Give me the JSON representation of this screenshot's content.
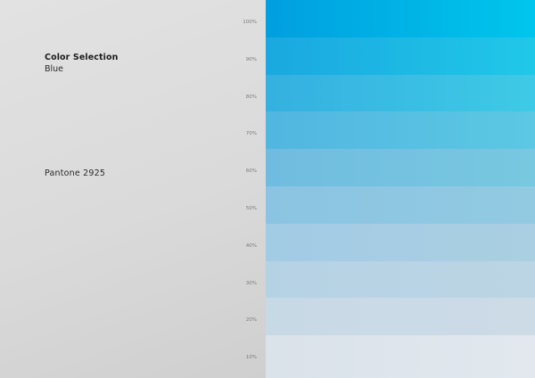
{
  "selection": {
    "heading": "Color Selection",
    "color_name": "Blue",
    "pantone": "Pantone 2925"
  },
  "tints": [
    {
      "label": "100%",
      "tint": 1.0,
      "color_start": "#009fdf",
      "color_end": "#00c6ec"
    },
    {
      "label": "90%",
      "tint": 0.9,
      "color_start": "#1aa8e0",
      "color_end": "#20c8e8"
    },
    {
      "label": "80%",
      "tint": 0.8,
      "color_start": "#35b0e0",
      "color_end": "#3ecae6"
    },
    {
      "label": "70%",
      "tint": 0.7,
      "color_start": "#52b6e0",
      "color_end": "#5cc8e4"
    },
    {
      "label": "60%",
      "tint": 0.6,
      "color_start": "#70bce0",
      "color_end": "#78c8e0"
    },
    {
      "label": "50%",
      "tint": 0.5,
      "color_start": "#8bc4e2",
      "color_end": "#92cae2"
    },
    {
      "label": "40%",
      "tint": 0.4,
      "color_start": "#a2cbe4",
      "color_end": "#aacfe2"
    },
    {
      "label": "30%",
      "tint": 0.3,
      "color_start": "#b5d2e4",
      "color_end": "#bcd5e4"
    },
    {
      "label": "20%",
      "tint": 0.2,
      "color_start": "#c8d9e6",
      "color_end": "#ccdbe6"
    },
    {
      "label": "10%",
      "tint": 0.1,
      "color_start": "#dae2ea",
      "color_end": "#e2e8ee"
    }
  ]
}
